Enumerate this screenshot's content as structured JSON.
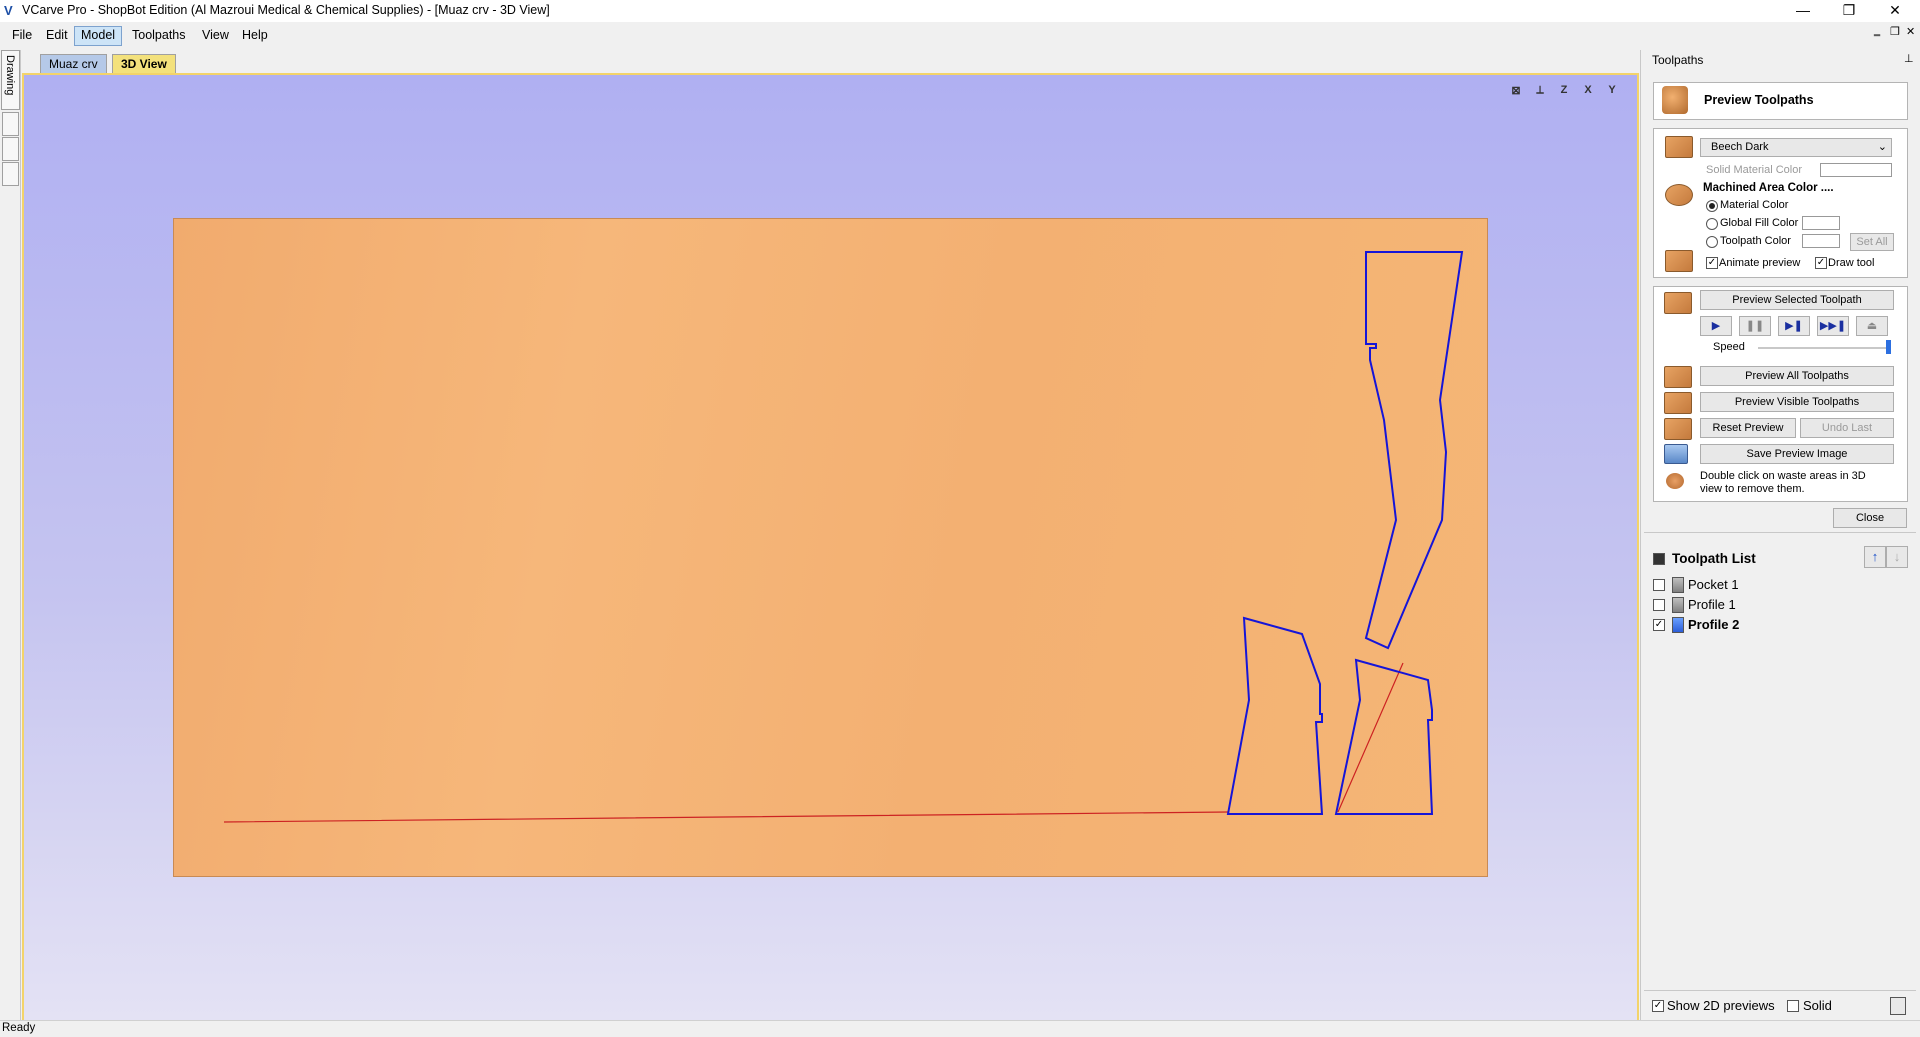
{
  "window": {
    "title": "VCarve Pro - ShopBot Edition (Al Mazroui Medical & Chemical Supplies) - [Muaz crv - 3D View]",
    "logo": "V",
    "minimize": "—",
    "maximize": "❐",
    "close": "✕"
  },
  "menu": {
    "items": [
      "File",
      "Edit",
      "Model",
      "Toolpaths",
      "View",
      "Help"
    ],
    "active": "Model",
    "mdi": {
      "minimize": "‗",
      "restore": "❐",
      "close": "✕"
    }
  },
  "left_strip": {
    "drawing_label": "Drawing"
  },
  "doc_tabs": [
    "Muaz crv",
    "3D View"
  ],
  "view_tools": [
    "⊠",
    "⟂",
    "Z",
    "X",
    "Y"
  ],
  "status": {
    "text": "Ready"
  },
  "panel": {
    "title": "Toolpaths",
    "pin": "⊥",
    "preview_header": "Preview Toolpaths",
    "material": {
      "selected": "Beech Dark",
      "solid_color_label": "Solid Material Color",
      "machined_area_label": "Machined Area Color ....",
      "options": [
        "Material Color",
        "Global Fill Color",
        "Toolpath Color"
      ],
      "selected_option": "Material Color",
      "set_all": "Set All",
      "animate_preview": "Animate preview",
      "draw_tool": "Draw tool"
    },
    "buttons": {
      "preview_selected": "Preview Selected Toolpath",
      "speed_label": "Speed",
      "speed_level": 1.0,
      "preview_all": "Preview All Toolpaths",
      "preview_visible": "Preview Visible Toolpaths",
      "reset_preview": "Reset Preview",
      "undo_last": "Undo Last",
      "save_image": "Save Preview Image",
      "hint": "Double click on waste areas in 3D view to remove them.",
      "close": "Close"
    },
    "controls": [
      "▶",
      "❚❚",
      "▶❚",
      "▶▶❚",
      "⏏"
    ],
    "toolpath_list": {
      "title": "Toolpath List",
      "items": [
        {
          "name": "Pocket 1",
          "checked": false
        },
        {
          "name": "Profile 1",
          "checked": false
        },
        {
          "name": "Profile 2",
          "checked": true
        }
      ]
    },
    "footer": {
      "show_2d": "Show 2D previews",
      "solid": "Solid"
    }
  },
  "colors": {
    "toolpath": "#1515d8",
    "rapid": "#cc2222",
    "highlight": "#f3d36a",
    "wood": "#f3b072"
  }
}
